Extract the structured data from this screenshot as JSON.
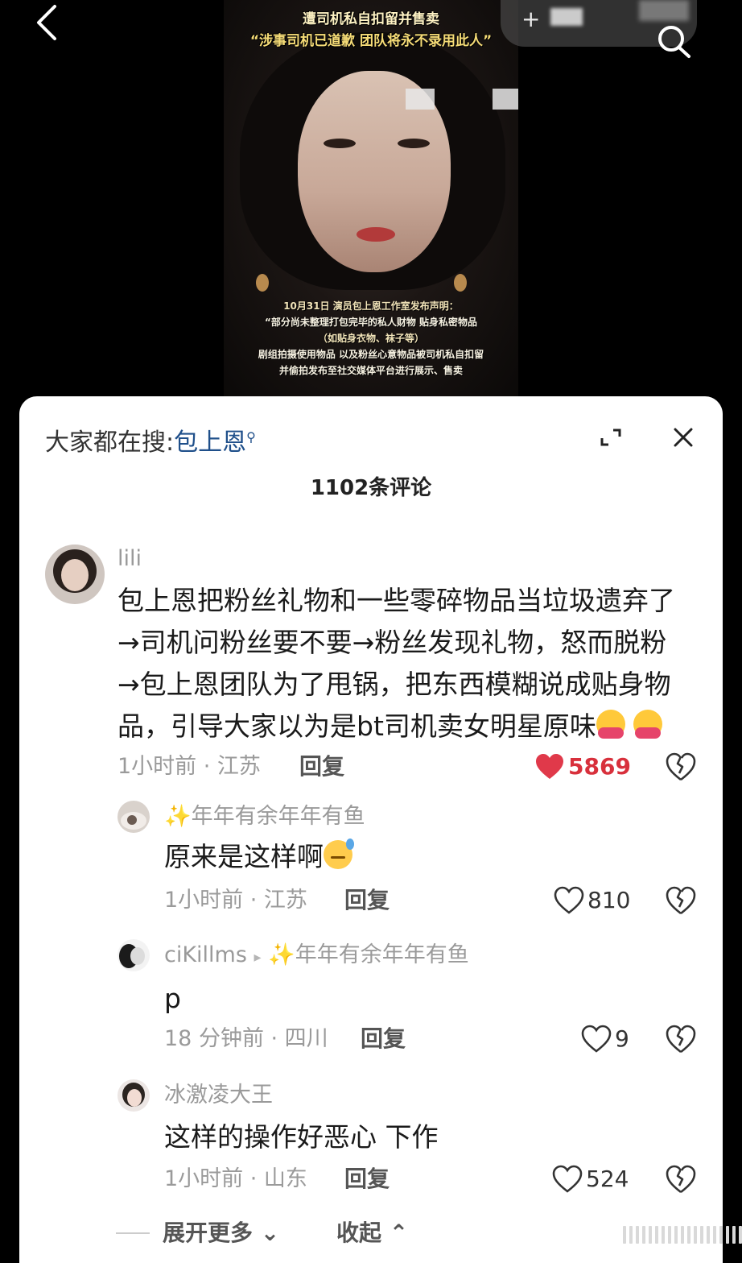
{
  "video": {
    "title_line1": "遭司机私自扣留并售卖",
    "title_line2": "“涉事司机已道歉 团队将永不录用此人”",
    "caption_lines": [
      "10月31日 演员包上恩工作室发布声明：",
      "“部分尚未整理打包完毕的私人财物 贴身私密物品",
      "（如贴身衣物、袜子等）",
      "剧组拍摄使用物品 以及粉丝心意物品被司机私自扣留",
      "并偷拍发布至社交媒体平台进行展示、售卖"
    ],
    "plus_label": "+"
  },
  "sheet": {
    "hot_prefix": "大家都在搜:",
    "hot_keyword": "包上恩",
    "comment_count": "1102条评论"
  },
  "comments": [
    {
      "user": "lili",
      "text": "包上恩把粉丝礼物和一些零碎物品当垃圾遗弃了\n→司机问粉丝要不要→粉丝发现礼物，怒而脱粉\n→包上恩团队为了甩锅，把东西模糊说成贴身物\n品，引导大家以为是bt司机卖女明星原味",
      "meta": "1小时前 · 江苏",
      "reply": "回复",
      "likes": "5869",
      "liked": true
    }
  ],
  "replies": [
    {
      "user": "年年有余年年有鱼",
      "text": "原来是这样啊",
      "meta": "1小时前 · 江苏",
      "reply": "回复",
      "likes": "810"
    },
    {
      "user": "ciKillms",
      "reply_to": "年年有余年年有鱼",
      "text": "p",
      "meta": "18 分钟前 · 四川",
      "reply": "回复",
      "likes": "9"
    },
    {
      "user": "冰激凌大王",
      "text": "这样的操作好恶心 下作",
      "meta": "1小时前 · 山东",
      "reply": "回复",
      "likes": "524"
    }
  ],
  "footer": {
    "expand_more": "展开更多",
    "collapse": "收起"
  },
  "colors": {
    "like_red": "#d8303c",
    "keyword_blue": "#1f4f8a",
    "caption_gold": "#f6dc77"
  }
}
